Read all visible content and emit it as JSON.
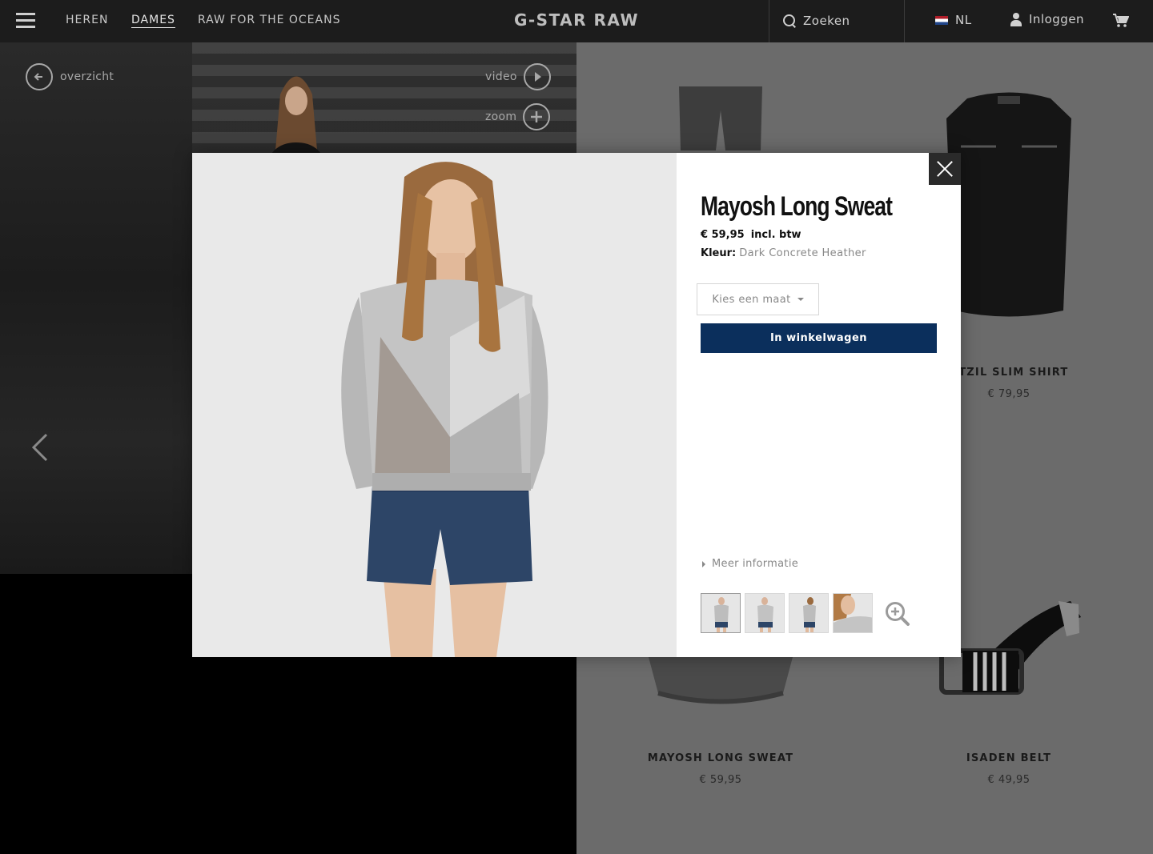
{
  "nav": {
    "links": [
      "HEREN",
      "DAMES",
      "RAW FOR THE OCEANS"
    ],
    "logo": "G-STAR RAW",
    "search_label": "Zoeken",
    "language": "NL",
    "login_label": "Inloggen"
  },
  "hero": {
    "back_label": "overzicht",
    "video_label": "video",
    "zoom_label": "zoom"
  },
  "grid": {
    "products": [
      {
        "name": "UTZIL SLIM SHIRT",
        "price": "€ 79,95"
      },
      {
        "name": "MAYOSH LONG SWEAT",
        "price": "€ 59,95"
      },
      {
        "name": "ISADEN BELT",
        "price": "€ 49,95"
      }
    ]
  },
  "modal": {
    "title": "Mayosh Long Sweat",
    "price": "€ 59,95",
    "vat_note": "incl. btw",
    "color_label": "Kleur:",
    "color_value": "Dark Concrete Heather",
    "size_placeholder": "Kies een maat",
    "add_to_cart_label": "In winkelwagen",
    "more_info_label": "Meer informatie",
    "thumbnail_count": 4
  },
  "colors": {
    "nav_bg": "#1c1c1c",
    "accent_button": "#0b2f5c",
    "muted_text": "#888888"
  }
}
